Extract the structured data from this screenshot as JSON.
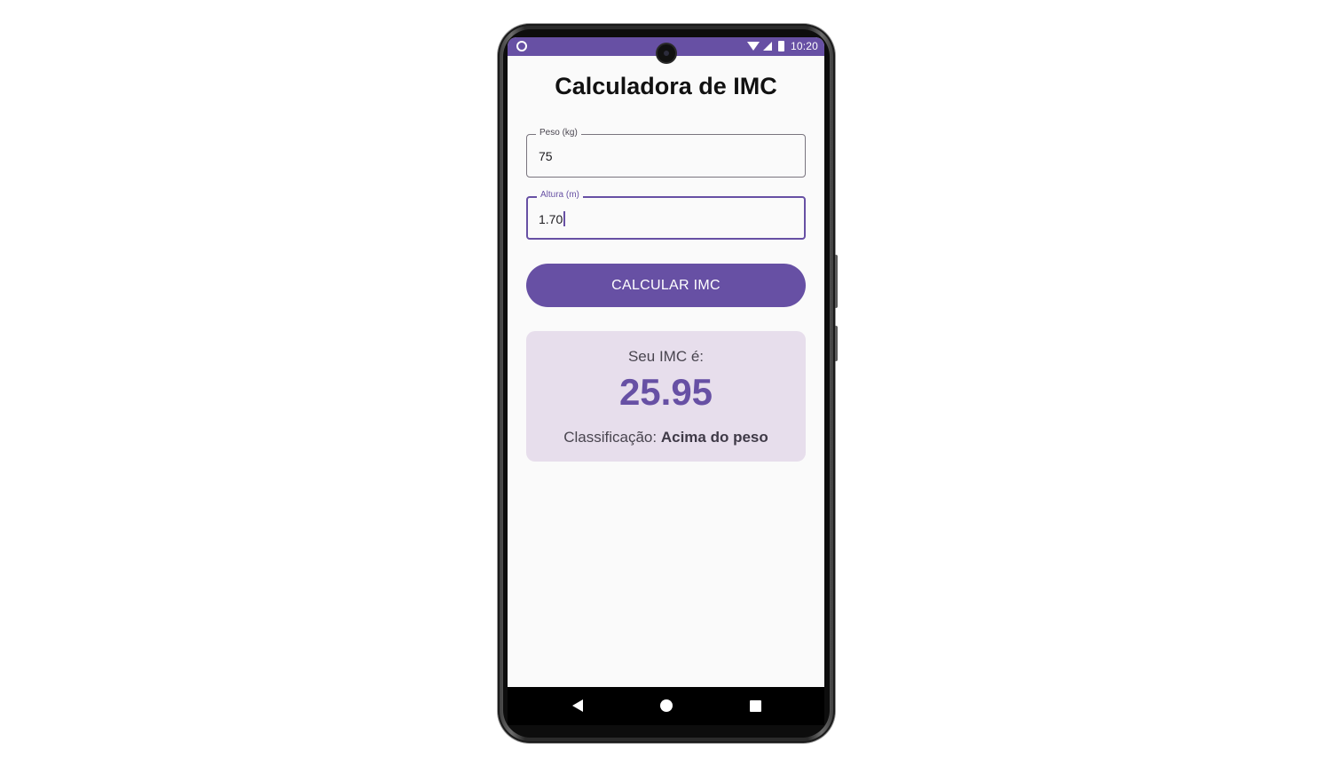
{
  "status_bar": {
    "time": "10:20",
    "color": "#6750a4"
  },
  "app": {
    "title": "Calculadora de IMC",
    "accent_color": "#6750a4"
  },
  "form": {
    "weight": {
      "label": "Peso (kg)",
      "value": "75"
    },
    "height": {
      "label": "Altura (m)",
      "value": "1.70",
      "focused": true
    }
  },
  "button": {
    "label": "CALCULAR IMC"
  },
  "result": {
    "label": "Seu IMC é:",
    "value": "25.95",
    "classification_label": "Classificação:",
    "classification_value": "Acima do peso",
    "card_color": "#e7deec"
  },
  "nav_bar": {
    "back_icon": "triangle-back",
    "home_icon": "circle-home",
    "recents_icon": "square-recents"
  }
}
